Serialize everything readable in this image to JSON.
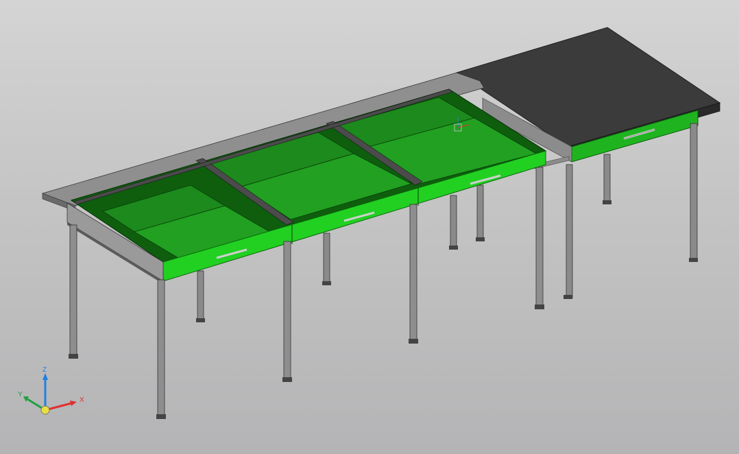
{
  "viewport": {
    "background_top": "#d4d4d4",
    "background_bottom": "#b4b4b6"
  },
  "model": {
    "drawer_color": "#19ba19",
    "drawer_bright": "#22dd22",
    "frame_color": "#6c6c6c",
    "top_color": "#3a3a3a",
    "leg_color": "#8a8a8a"
  },
  "triad": {
    "x_label": "X",
    "y_label": "Y",
    "z_label": "Z",
    "x_color": "#e03030",
    "y_color": "#20a040",
    "z_color": "#2080e0"
  }
}
